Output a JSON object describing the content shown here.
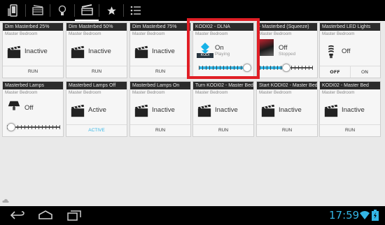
{
  "colors": {
    "accent": "#33b5e5",
    "highlight": "#e01e25",
    "tile_header": "#2b2b2b"
  },
  "topbar": {
    "tabs": [
      {
        "icon": "phone-icon"
      },
      {
        "icon": "film-icon"
      },
      {
        "icon": "bulb-icon"
      },
      {
        "icon": "clapperboard-icon",
        "active": true
      },
      {
        "icon": "star-icon"
      },
      {
        "icon": "list-icon"
      }
    ]
  },
  "tiles": [
    {
      "title": "Dim Masterbed 25%",
      "room": "Master Bedroom",
      "state": "Inactive",
      "button": "RUN"
    },
    {
      "title": "Dim Masterbed 50%",
      "room": "Master Bedroom",
      "state": "Inactive",
      "button": "RUN"
    },
    {
      "title": "Dim Masterbed 75%",
      "room": "Master Bedroom",
      "state": "Inactive",
      "button": "RUN"
    },
    {
      "title": "KODI02 - DLNA",
      "room": "Master Bedroom",
      "state": "On",
      "sub": "Playing",
      "level": 0.92
    },
    {
      "title": "- Masterbed (Squeeze)",
      "room": "Master Bedroom",
      "state": "Off",
      "sub": "Stopped",
      "level": 0.5
    },
    {
      "title": "Masterbed LED Lights",
      "room": "Master Bedroom",
      "state": "Off",
      "button_off": "OFF",
      "button_on": "ON"
    },
    {
      "title": "Masterbed Lamps",
      "room": "Master Bedroom",
      "state": "Off",
      "level": 0.05
    },
    {
      "title": "Masterbed Lamps Off",
      "room": "Master Bedroom",
      "state": "Active",
      "button": "ACTIVE"
    },
    {
      "title": "Masterbed Lamps On",
      "room": "Master Bedroom",
      "state": "Inactive",
      "button": "RUN"
    },
    {
      "title": "Turn KODI02 - Master Bed",
      "room": "Master Bedroom",
      "state": "Inactive",
      "button": "RUN"
    },
    {
      "title": "Start KODI02 - Master Bed",
      "room": "Master Bedroom",
      "state": "Inactive",
      "button": "RUN"
    },
    {
      "title": "KODI02 - Master Bed",
      "room": "Master Bedroom",
      "state": "Inactive",
      "button": "RUN"
    }
  ],
  "kodi_logo_text": "KODI",
  "status": {
    "time": "17:59"
  }
}
